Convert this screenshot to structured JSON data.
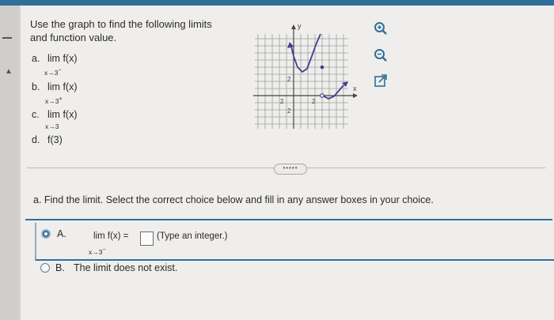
{
  "prompt": "Use the graph to find the following limits and function value.",
  "parts": [
    {
      "label": "a.",
      "expr": "lim f(x)",
      "sub": "x→3",
      "sup": "−"
    },
    {
      "label": "b.",
      "expr": "lim f(x)",
      "sub": "x→3",
      "sup": "+"
    },
    {
      "label": "c.",
      "expr": "lim f(x)",
      "sub": "x→3",
      "sup": ""
    },
    {
      "label": "d.",
      "expr": "f(3)",
      "sub": "",
      "sup": ""
    }
  ],
  "graph": {
    "x_axis_label": "x",
    "y_axis_label": "y",
    "tick_labels": [
      "2",
      "2",
      "2",
      "2"
    ]
  },
  "tools": [
    "zoom-in-icon",
    "zoom-out-icon",
    "external-link-icon"
  ],
  "expander_text": "•••••",
  "question": "a. Find the limit. Select the correct choice below and fill in any answer boxes in your choice.",
  "choices": [
    {
      "letter": "A.",
      "expr": "lim f(x) =",
      "sub": "x→3",
      "sup": "−",
      "hint": "(Type an integer.)",
      "selected": true
    },
    {
      "letter": "B.",
      "text": "The limit does not exist.",
      "selected": false
    }
  ],
  "colors": {
    "accent": "#2f6f98",
    "curve": "#4a3a8f"
  }
}
